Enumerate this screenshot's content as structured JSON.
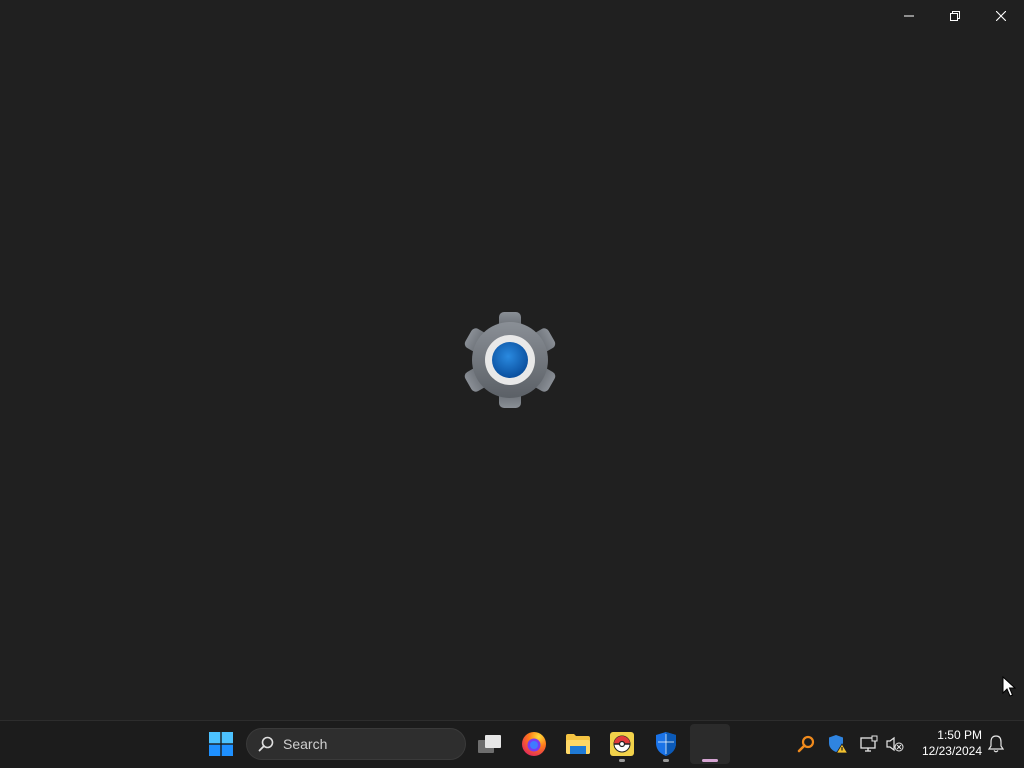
{
  "window": {
    "caption_buttons": {
      "minimize_icon": "minimize-icon",
      "restore_icon": "restore-icon",
      "close_icon": "close-icon"
    },
    "splash_icon": "settings-gear-icon"
  },
  "taskbar": {
    "start_icon": "windows-start-icon",
    "search": {
      "placeholder": "Search"
    },
    "pinned": [
      {
        "name": "task-view",
        "icon": "task-view-icon"
      },
      {
        "name": "firefox",
        "icon": "firefox-icon"
      },
      {
        "name": "file-explorer",
        "icon": "folder-icon"
      },
      {
        "name": "pokemon-app",
        "icon": "pokeball-icon",
        "running": true
      },
      {
        "name": "windows-security",
        "icon": "shield-icon",
        "running": true
      },
      {
        "name": "settings",
        "icon": "blank-app-icon",
        "active": true
      }
    ],
    "tray": {
      "icons": [
        "search-tool-icon",
        "security-warning-icon",
        "network-icon",
        "volume-muted-icon"
      ],
      "time": "1:50 PM",
      "date": "12/23/2024",
      "notification_icon": "bell-icon"
    }
  },
  "colors": {
    "background": "#202020",
    "taskbar": "#1c1c1c",
    "accent_blue": "#0f6cbd",
    "active_indicator": "#d7a6d4"
  }
}
